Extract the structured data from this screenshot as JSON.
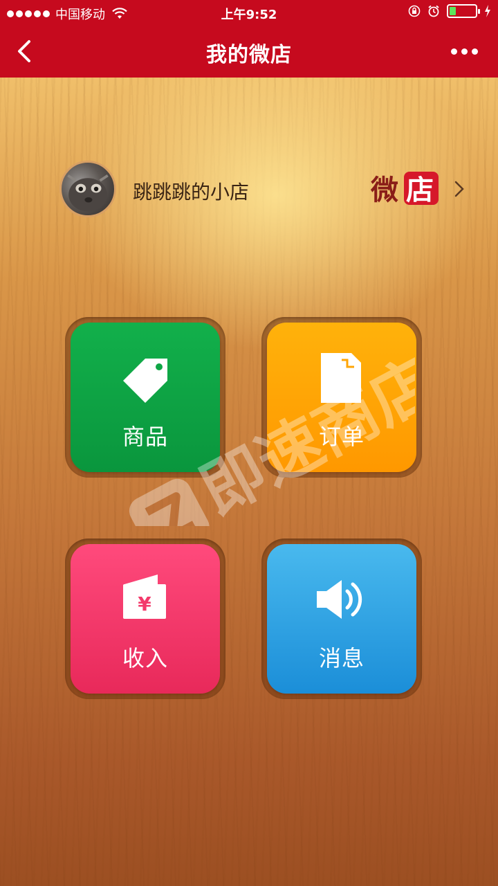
{
  "status_bar": {
    "carrier": "中国移动",
    "time": "上午9:52",
    "battery_level": 0.25
  },
  "nav": {
    "title": "我的微店"
  },
  "shop": {
    "name": "跳跳跳的小店",
    "logo_char_1": "微",
    "logo_char_2": "店"
  },
  "tiles": [
    {
      "label": "商品",
      "icon": "tag-icon",
      "color": "#0fa646"
    },
    {
      "label": "订单",
      "icon": "document-icon",
      "color": "#ffa506"
    },
    {
      "label": "收入",
      "icon": "wallet-icon",
      "color": "#f33a6b"
    },
    {
      "label": "消息",
      "icon": "speaker-icon",
      "color": "#33a6e6"
    }
  ],
  "watermark": {
    "text": "即速商店"
  },
  "colors": {
    "nav_bg": "#c60a1e",
    "logo_red": "#d6182a",
    "logo_dark": "#8a1e18"
  }
}
